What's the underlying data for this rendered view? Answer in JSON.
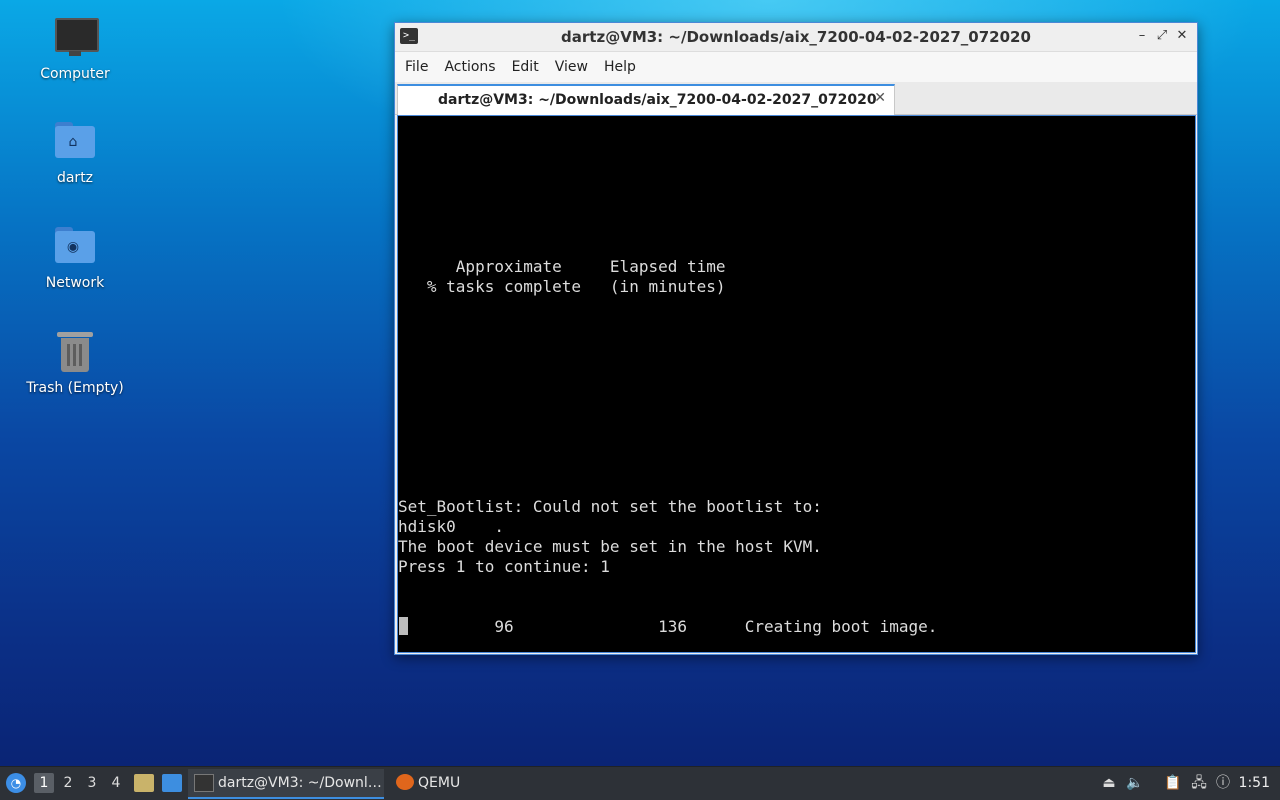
{
  "desktop": {
    "icons": [
      {
        "label": "Computer",
        "icon": "computer-icon"
      },
      {
        "label": "dartz",
        "icon": "home-folder-icon"
      },
      {
        "label": "Network",
        "icon": "network-folder-icon"
      },
      {
        "label": "Trash (Empty)",
        "icon": "trash-icon"
      }
    ]
  },
  "window": {
    "title": "dartz@VM3: ~/Downloads/aix_7200-04-02-2027_072020",
    "controls": {
      "minimize": "–",
      "maximize": "⤢",
      "close": "✕"
    },
    "menu": [
      "File",
      "Actions",
      "Edit",
      "View",
      "Help"
    ],
    "tab": {
      "label": "dartz@VM3: ~/Downloads/aix_7200-04-02-2027_072020",
      "close": "✕"
    },
    "terminal": {
      "lines": [
        "      Approximate     Elapsed time",
        "   % tasks complete   (in minutes)",
        "Set_Bootlist: Could not set the bootlist to:",
        "hdisk0    .",
        "The boot device must be set in the host KVM.",
        "Press 1 to continue: 1",
        "          96               136      Creating boot image."
      ]
    }
  },
  "taskbar": {
    "workspaces": [
      "1",
      "2",
      "3",
      "4"
    ],
    "active_workspace": "1",
    "tasks": [
      {
        "label": "dartz@VM3: ~/Downl…",
        "icon": "terminal-icon",
        "active": true
      },
      {
        "label": "QEMU",
        "icon": "qemu-icon",
        "active": false
      }
    ],
    "clock": "1:51"
  }
}
